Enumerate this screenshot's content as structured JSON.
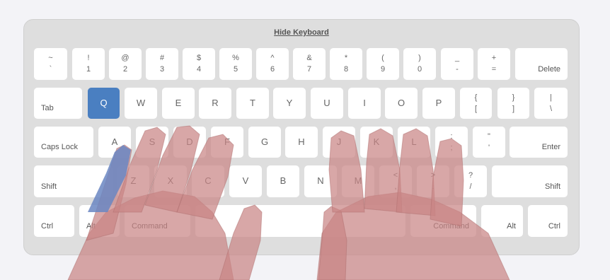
{
  "keyboard": {
    "hide_label": "Hide Keyboard",
    "row1": [
      {
        "top": "~",
        "bot": "`"
      },
      {
        "top": "!",
        "bot": "1"
      },
      {
        "top": "@",
        "bot": "2"
      },
      {
        "top": "#",
        "bot": "3"
      },
      {
        "top": "$",
        "bot": "4"
      },
      {
        "top": "%",
        "bot": "5"
      },
      {
        "top": "^",
        "bot": "6"
      },
      {
        "top": "&",
        "bot": "7"
      },
      {
        "top": "*",
        "bot": "8"
      },
      {
        "top": "(",
        "bot": "9"
      },
      {
        "top": ")",
        "bot": "0"
      },
      {
        "top": "_",
        "bot": "-"
      },
      {
        "top": "+",
        "bot": "="
      }
    ],
    "delete_label": "Delete",
    "tab_label": "Tab",
    "row2": [
      "Q",
      "W",
      "E",
      "R",
      "T",
      "Y",
      "U",
      "I",
      "O",
      "P"
    ],
    "row2_symbols": [
      {
        "top": "{",
        "bot": "["
      },
      {
        "top": "}",
        "bot": "]"
      },
      {
        "top": "|",
        "bot": "\\"
      }
    ],
    "active_key": "Q",
    "active_color": "#4a7fc1",
    "caps_label": "Caps Lock",
    "row3": [
      "A",
      "S",
      "D",
      "F",
      "G",
      "H",
      "J",
      "K",
      "L"
    ],
    "row3_symbols": [
      {
        "top": ":",
        "bot": ";"
      },
      {
        "top": "\"",
        "bot": "'"
      }
    ],
    "enter_label": "Enter",
    "shift_left_label": "Shift",
    "row4": [
      "Z",
      "X",
      "C",
      "V",
      "B",
      "N",
      "M"
    ],
    "row4_symbols": [
      {
        "top": "<",
        "bot": ","
      },
      {
        "top": ">",
        "bot": "."
      },
      {
        "top": "?",
        "bot": "/"
      }
    ],
    "shift_right_label": "Shift",
    "ctrl_left_label": "Ctrl",
    "alt_left_label": "Alt",
    "command_left_label": "Command",
    "command_right_label": "Command",
    "alt_right_label": "Alt",
    "ctrl_right_label": "Ctrl"
  },
  "overlay": {
    "hand_color": "#c98585",
    "finger_highlight_color": "#6a86c2"
  }
}
